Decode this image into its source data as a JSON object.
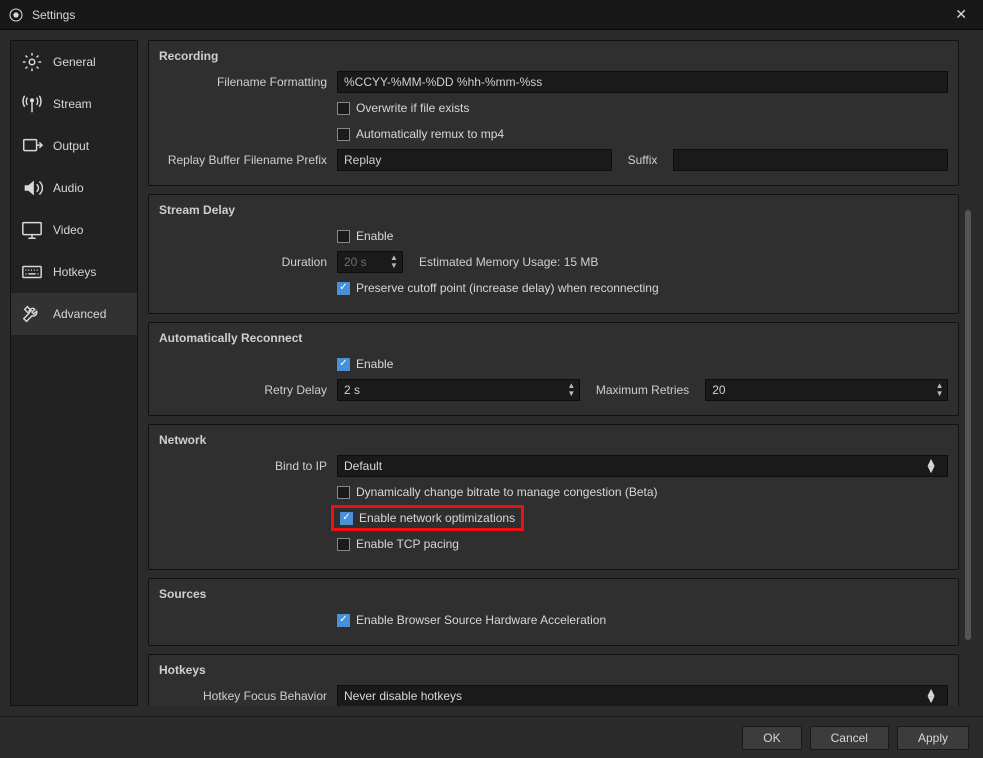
{
  "title": "Settings",
  "sidebar": {
    "items": [
      {
        "label": "General"
      },
      {
        "label": "Stream"
      },
      {
        "label": "Output"
      },
      {
        "label": "Audio"
      },
      {
        "label": "Video"
      },
      {
        "label": "Hotkeys"
      },
      {
        "label": "Advanced"
      }
    ]
  },
  "recording": {
    "heading": "Recording",
    "filename_formatting_label": "Filename Formatting",
    "filename_formatting_value": "%CCYY-%MM-%DD %hh-%mm-%ss",
    "overwrite_label": "Overwrite if file exists",
    "overwrite_checked": false,
    "remux_label": "Automatically remux to mp4",
    "remux_checked": false,
    "replay_prefix_label": "Replay Buffer Filename Prefix",
    "replay_prefix_value": "Replay",
    "suffix_label": "Suffix",
    "suffix_value": ""
  },
  "stream_delay": {
    "heading": "Stream Delay",
    "enable_label": "Enable",
    "enable_checked": false,
    "duration_label": "Duration",
    "duration_value": "20 s",
    "estimated_label": "Estimated Memory Usage: 15 MB",
    "preserve_label": "Preserve cutoff point (increase delay) when reconnecting",
    "preserve_checked": true
  },
  "reconnect": {
    "heading": "Automatically Reconnect",
    "enable_label": "Enable",
    "enable_checked": true,
    "retry_delay_label": "Retry Delay",
    "retry_delay_value": "2 s",
    "max_retries_label": "Maximum Retries",
    "max_retries_value": "20"
  },
  "network": {
    "heading": "Network",
    "bind_label": "Bind to IP",
    "bind_value": "Default",
    "dyn_label": "Dynamically change bitrate to manage congestion (Beta)",
    "dyn_checked": false,
    "opt_label": "Enable network optimizations",
    "opt_checked": true,
    "tcp_label": "Enable TCP pacing",
    "tcp_checked": false
  },
  "sources": {
    "heading": "Sources",
    "hw_label": "Enable Browser Source Hardware Acceleration",
    "hw_checked": true
  },
  "hotkeys": {
    "heading": "Hotkeys",
    "focus_label": "Hotkey Focus Behavior",
    "focus_value": "Never disable hotkeys"
  },
  "footer": {
    "ok": "OK",
    "cancel": "Cancel",
    "apply": "Apply"
  }
}
